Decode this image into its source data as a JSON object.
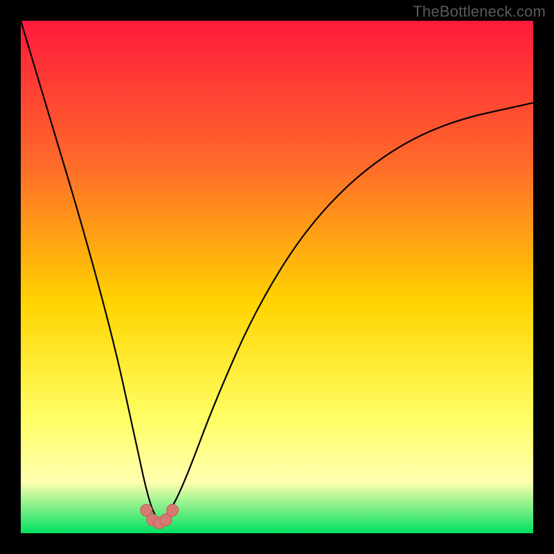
{
  "watermark": {
    "text": "TheBottleneck.com"
  },
  "colors": {
    "frame": "#000000",
    "grad_top": "#ff1a3c",
    "grad_mid1": "#ff6a2a",
    "grad_mid2": "#ffd400",
    "grad_low1": "#ffff66",
    "grad_low2": "#ffffb0",
    "grad_bottom": "#00e060",
    "curve": "#000000",
    "marker_fill": "#d87a74",
    "marker_stroke": "#c45c58"
  },
  "chart_data": {
    "type": "line",
    "title": "",
    "xlabel": "",
    "ylabel": "",
    "xlim": [
      0,
      100
    ],
    "ylim": [
      0,
      100
    ],
    "notes": "Background is a vertical color gradient from red (top, high bottleneck) through orange and yellow to green (bottom, low bottleneck). The curve is a V-shaped bottleneck curve reaching a minimum near x≈27 where markers are clustered. No axis ticks or labels are shown; values are estimated from pixel positions.",
    "series": [
      {
        "name": "bottleneck-curve",
        "x": [
          0,
          6,
          12,
          18,
          22,
          25,
          27,
          29,
          32,
          38,
          46,
          56,
          68,
          82,
          100
        ],
        "y": [
          100,
          80,
          60,
          38,
          20,
          6,
          2,
          4,
          10,
          26,
          44,
          60,
          72,
          80,
          84
        ]
      }
    ],
    "markers": {
      "name": "highlighted-points",
      "x": [
        24.5,
        25.7,
        27.0,
        28.3,
        29.6
      ],
      "y": [
        4.5,
        2.6,
        2.0,
        2.6,
        4.5
      ]
    }
  }
}
